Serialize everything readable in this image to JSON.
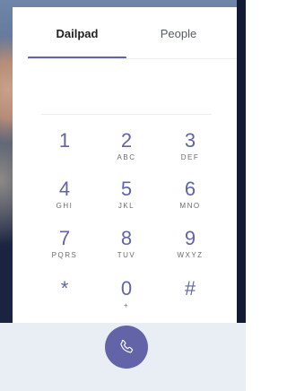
{
  "tabs": {
    "dialpad_label": "Dailpad",
    "people_label": "People"
  },
  "display": {
    "value": ""
  },
  "keys": [
    {
      "digit": "1",
      "letters": ""
    },
    {
      "digit": "2",
      "letters": "ABC"
    },
    {
      "digit": "3",
      "letters": "DEF"
    },
    {
      "digit": "4",
      "letters": "GHI"
    },
    {
      "digit": "5",
      "letters": "JKL"
    },
    {
      "digit": "6",
      "letters": "MNO"
    },
    {
      "digit": "7",
      "letters": "PQRS"
    },
    {
      "digit": "8",
      "letters": "TUV"
    },
    {
      "digit": "9",
      "letters": "WXYZ"
    },
    {
      "digit": "*",
      "letters": ""
    },
    {
      "digit": "0",
      "letters": "+"
    },
    {
      "digit": "#",
      "letters": ""
    }
  ],
  "call_button": {
    "icon": "phone-icon"
  },
  "colors": {
    "accent": "#6264a7"
  }
}
